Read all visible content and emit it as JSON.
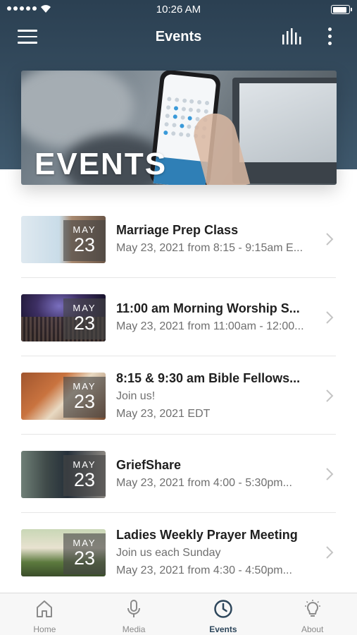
{
  "status_bar": {
    "time": "10:26 AM",
    "battery_level": 0.95
  },
  "header": {
    "title": "Events",
    "menu_icon": "hamburger-menu-icon",
    "chart_icon": "bar-chart-icon",
    "more_icon": "more-vertical-icon"
  },
  "hero": {
    "text": "EVENTS"
  },
  "events": [
    {
      "month": "MAY",
      "day": "23",
      "title": "Marriage Prep Class",
      "lines": [
        "May 23, 2021 from 8:15 - 9:15am E..."
      ]
    },
    {
      "month": "MAY",
      "day": "23",
      "title": "11:00 am Morning Worship S...",
      "lines": [
        "May 23, 2021 from 11:00am - 12:00..."
      ]
    },
    {
      "month": "MAY",
      "day": "23",
      "title": "8:15 & 9:30 am Bible Fellows...",
      "lines": [
        "Join us!",
        "May 23, 2021 EDT"
      ]
    },
    {
      "month": "MAY",
      "day": "23",
      "title": "GriefShare",
      "lines": [
        "May 23, 2021 from 4:00 - 5:30pm..."
      ]
    },
    {
      "month": "MAY",
      "day": "23",
      "title": "Ladies Weekly Prayer Meeting",
      "lines": [
        "Join us each Sunday",
        "May 23, 2021 from 4:30 - 4:50pm..."
      ]
    }
  ],
  "tabs": [
    {
      "label": "Home",
      "icon": "home-icon",
      "active": false
    },
    {
      "label": "Media",
      "icon": "microphone-icon",
      "active": false
    },
    {
      "label": "Events",
      "icon": "clock-icon",
      "active": true
    },
    {
      "label": "About",
      "icon": "lightbulb-icon",
      "active": false
    }
  ],
  "colors": {
    "header_bg": "#2f4556",
    "active_tab": "#2e475c",
    "inactive_tab": "#8a8a8a",
    "date_badge_bg": "#464646"
  }
}
